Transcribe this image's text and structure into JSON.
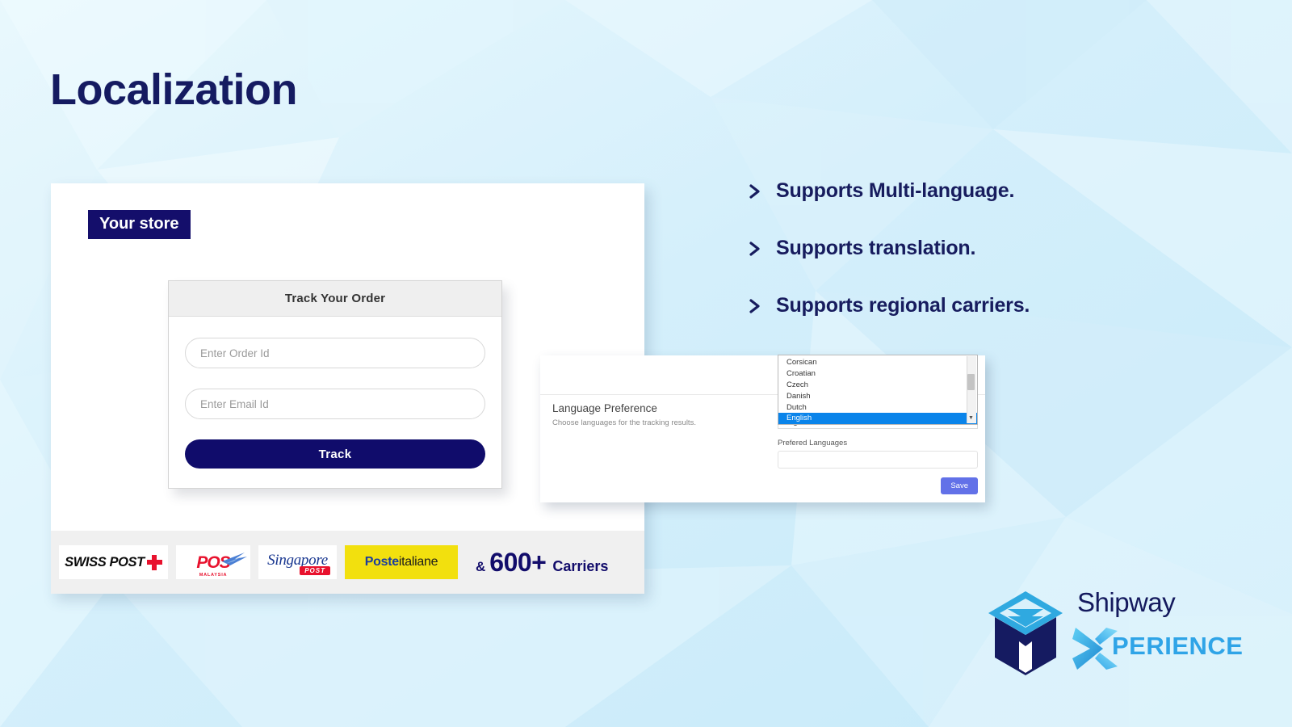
{
  "page": {
    "title": "Localization",
    "background_color": "#d9f1fb",
    "accent_navy": "#151b61",
    "accent_cyan": "#2fa4e7"
  },
  "store_preview": {
    "badge_label": "Your store",
    "track_panel": {
      "header": "Track Your Order",
      "order_input_placeholder": "Enter Order Id",
      "order_input_value": "",
      "email_input_placeholder": "Enter Email Id",
      "email_input_value": "",
      "track_button_label": "Track"
    },
    "carriers": {
      "logos": [
        {
          "name": "swiss-post",
          "line1": "SWISS POST",
          "mark": "red-cross"
        },
        {
          "name": "pos-malaysia",
          "line1": "POS",
          "line2": "MALAYSIA"
        },
        {
          "name": "singapore-post",
          "line1": "Singapore",
          "line2": "POST"
        },
        {
          "name": "poste-italiane",
          "line1": "Poste",
          "line2": "italiane"
        }
      ],
      "count_amp": "&",
      "count_number": "600+",
      "count_word": "Carriers"
    }
  },
  "language_dialog": {
    "title": "Language Preference",
    "subtitle": "Choose languages for the tracking results.",
    "select_value": "English",
    "options": [
      "Corsican",
      "Croatian",
      "Czech",
      "Danish",
      "Dutch",
      "English"
    ],
    "selected_option": "English",
    "preferred_label": "Prefered Languages",
    "preferred_value": "",
    "save_label": "Save",
    "highlight_color": "#0a84ea",
    "save_color": "#6271e8"
  },
  "bullets": [
    {
      "text": "Supports Multi-language."
    },
    {
      "text": "Supports translation."
    },
    {
      "text": "Supports regional carriers."
    }
  ],
  "brand": {
    "name": "Shipway",
    "product": "PERIENCE",
    "product_initial": "X"
  }
}
